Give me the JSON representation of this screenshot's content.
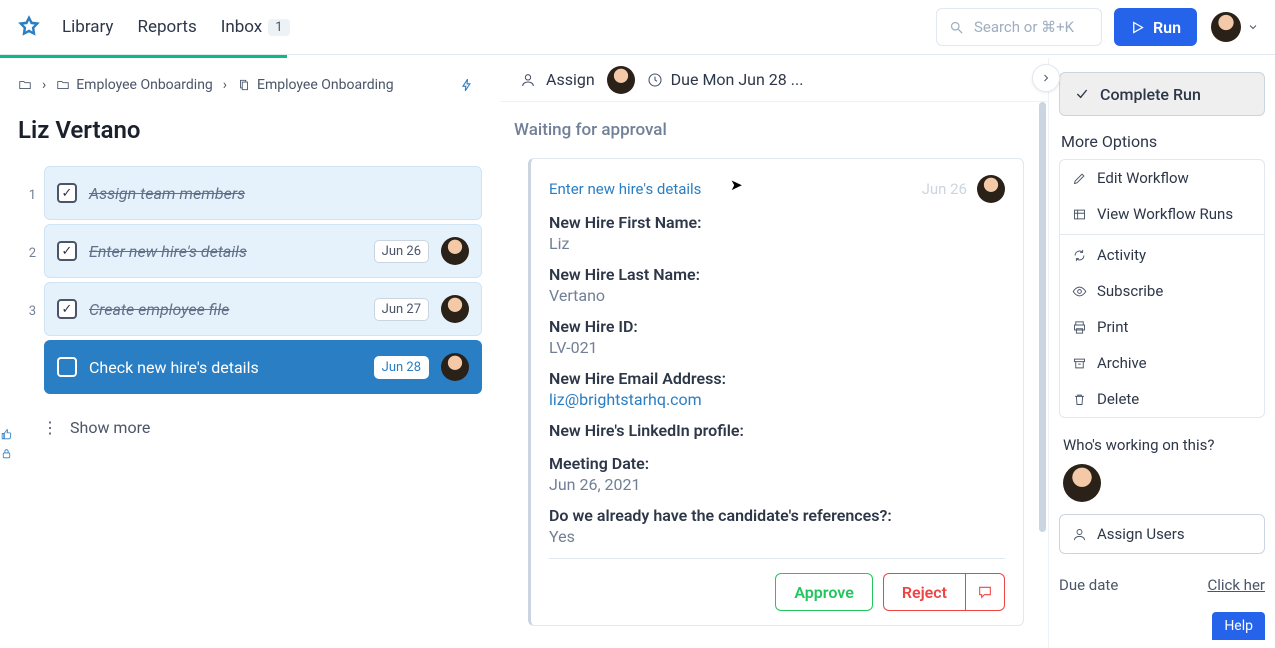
{
  "nav": {
    "library": "Library",
    "reports": "Reports",
    "inbox": "Inbox",
    "inbox_count": "1",
    "search_placeholder": "Search or ⌘+K",
    "run": "Run"
  },
  "crumbs": {
    "a": "Employee Onboarding",
    "b": "Employee Onboarding"
  },
  "run_title": "Liz Vertano",
  "tasks": [
    {
      "num": "1",
      "label": "Assign team members",
      "date": "",
      "done": true,
      "active": false,
      "avatar": false
    },
    {
      "num": "2",
      "label": "Enter new hire's details",
      "date": "Jun 26",
      "done": true,
      "active": false,
      "avatar": true
    },
    {
      "num": "3",
      "label": "Create employee file",
      "date": "Jun 27",
      "done": true,
      "active": false,
      "avatar": true
    },
    {
      "num": "",
      "label": "Check new hire's details",
      "date": "Jun 28",
      "done": false,
      "active": true,
      "avatar": true
    }
  ],
  "show_more": "Show more",
  "mid": {
    "assign": "Assign",
    "due": "Due Mon Jun 28 ...",
    "waiting": "Waiting for approval",
    "card_link": "Enter new hire's details",
    "card_date": "Jun 26",
    "fields": {
      "first_l": "New Hire First Name:",
      "first_v": "Liz",
      "last_l": "New Hire Last Name:",
      "last_v": "Vertano",
      "id_l": "New Hire ID:",
      "id_v": "LV-021",
      "email_l": "New Hire Email Address:",
      "email_v": "liz@brightstarhq.com",
      "li_l": "New Hire's LinkedIn profile:",
      "meet_l": "Meeting Date:",
      "meet_v": "Jun 26, 2021",
      "ref_l": "Do we already have the candidate's references?:",
      "ref_v": "Yes"
    },
    "approve": "Approve",
    "reject": "Reject"
  },
  "right": {
    "complete": "Complete Run",
    "more": "More Options",
    "edit": "Edit Workflow",
    "view": "View Workflow Runs",
    "activity": "Activity",
    "subscribe": "Subscribe",
    "print": "Print",
    "archive": "Archive",
    "delete": "Delete",
    "who": "Who's working on this?",
    "assign_users": "Assign Users",
    "due_l": "Due date",
    "due_set": "Click her"
  },
  "help": "Help"
}
